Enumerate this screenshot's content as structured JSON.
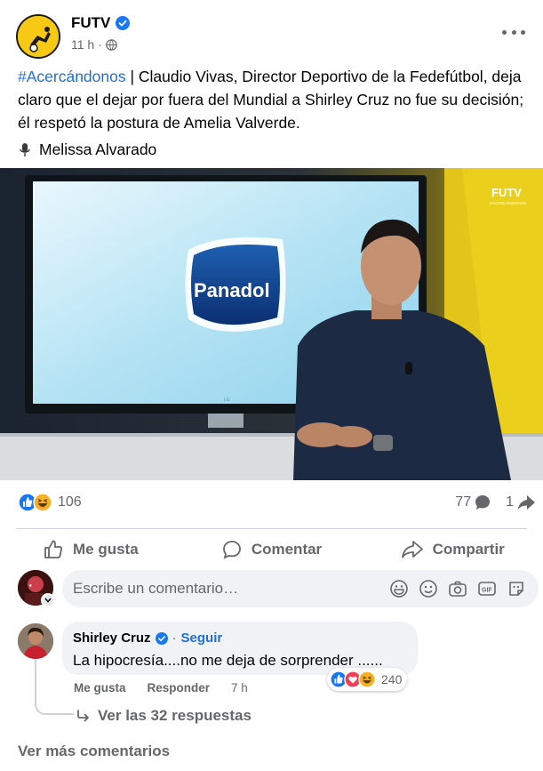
{
  "post": {
    "page_name": "FUTV",
    "time": "11 h",
    "hashtag": "#Acercándonos",
    "caption": " | Claudio Vivas, Director Deportivo de la Fedefútbol, deja claro que el dejar por fuera del Mundial a Shirley Cruz no fue su decisión; él respetó la postura de Amelia Valverde.",
    "byline": "Melissa Alvarado"
  },
  "media": {
    "screen_logo": "Panadol",
    "watermark": "FUTV",
    "watermark_sub": "#ACERCÁNDONOS",
    "monitor_brand": "LG"
  },
  "stats": {
    "reactions_count": "106",
    "comments_count": "77",
    "shares_count": "1"
  },
  "actions": {
    "like": "Me gusta",
    "comment": "Comentar",
    "share": "Compartir"
  },
  "composer": {
    "placeholder": "Escribe un comentario…"
  },
  "comment": {
    "author": "Shirley Cruz",
    "follow": "Seguir",
    "text": "La hipocresía....no me deja de sorprender ......",
    "reactions_count": "240",
    "like": "Me gusta",
    "reply": "Responder",
    "time": "7 h",
    "view_replies": "Ver las 32 respuestas"
  },
  "footer": {
    "more_comments": "Ver más comentarios"
  },
  "colors": {
    "link_blue": "#216fdb",
    "secondary_text": "#65676b",
    "bubble_bg": "#f0f2f5",
    "brand_yellow": "#f6c915"
  },
  "icons": [
    "verified-badge-icon",
    "globe-icon",
    "more-options-icon",
    "microphone-icon",
    "like-reaction-icon",
    "haha-reaction-icon",
    "love-reaction-icon",
    "comment-bubble-icon",
    "share-arrow-icon",
    "thumbs-up-icon",
    "speech-bubble-icon",
    "share-icon",
    "sticker-icon",
    "emoji-icon",
    "camera-icon",
    "gif-icon",
    "avatar-sticker-icon",
    "reply-arrow-icon"
  ]
}
